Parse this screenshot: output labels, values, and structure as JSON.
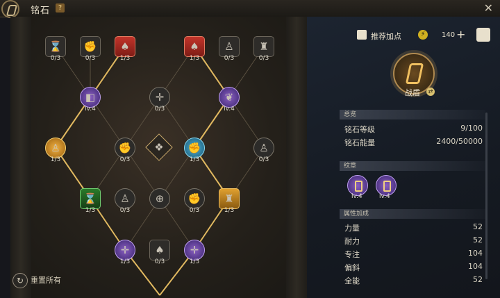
{
  "header": {
    "title": "铭石",
    "help": "?",
    "close": "✕"
  },
  "board": {
    "nodes": [
      {
        "count": "0/3",
        "style": "sq",
        "glyph": "⌛"
      },
      {
        "count": "0/3",
        "style": "sq",
        "glyph": "✊"
      },
      {
        "count": "1/3",
        "style": "sq red",
        "glyph": "♠"
      },
      {
        "count": "1/3",
        "style": "sq red",
        "glyph": "♠"
      },
      {
        "count": "0/3",
        "style": "sq",
        "glyph": "♙"
      },
      {
        "count": "0/3",
        "style": "sq",
        "glyph": "♜"
      },
      {
        "count": "lv.4",
        "style": "circ purple",
        "glyph": "◧"
      },
      {
        "count": "0/3",
        "style": "circ",
        "glyph": "✛"
      },
      {
        "count": "lv.4",
        "style": "circ purple",
        "glyph": "❦"
      },
      {
        "count": "1/3",
        "style": "circ gold",
        "glyph": "♙"
      },
      {
        "count": "0/3",
        "style": "circ",
        "glyph": "✊"
      },
      {
        "count": "",
        "style": "diamond",
        "glyph": "❖"
      },
      {
        "count": "1/3",
        "style": "circ cyan",
        "glyph": "✊"
      },
      {
        "count": "0/3",
        "style": "circ",
        "glyph": "♙"
      },
      {
        "count": "1/3",
        "style": "sq green",
        "glyph": "⌛"
      },
      {
        "count": "0/3",
        "style": "circ",
        "glyph": "♙"
      },
      {
        "count": "",
        "style": "circ",
        "glyph": "⊕"
      },
      {
        "count": "0/3",
        "style": "circ",
        "glyph": "✊"
      },
      {
        "count": "1/3",
        "style": "sq gold",
        "glyph": "♜"
      },
      {
        "count": "1/3",
        "style": "circ purple",
        "glyph": "✛"
      },
      {
        "count": "0/3",
        "style": "sq",
        "glyph": "♠"
      },
      {
        "count": "1/3",
        "style": "circ purple",
        "glyph": "✛"
      }
    ],
    "reset_label": "重置所有",
    "reset_icon": "↻"
  },
  "panel": {
    "recommend_label": "推荐加点",
    "points": "140",
    "plus": "+",
    "bolt": "⚡",
    "role": "战盾",
    "role_swap": "⇄",
    "overview": {
      "title": "总览",
      "rows": [
        {
          "label": "铭石等级",
          "value": "9/100"
        },
        {
          "label": "铭石能量",
          "value": "2400/50000"
        }
      ]
    },
    "badges": {
      "title": "纹章",
      "items": [
        {
          "level": "lv.4"
        },
        {
          "level": "lv.4"
        }
      ]
    },
    "attributes": {
      "title": "属性加成",
      "rows": [
        {
          "label": "力量",
          "value": "52"
        },
        {
          "label": "耐力",
          "value": "52"
        },
        {
          "label": "专注",
          "value": "104"
        },
        {
          "label": "偏斜",
          "value": "104"
        },
        {
          "label": "全能",
          "value": "52"
        }
      ]
    }
  }
}
